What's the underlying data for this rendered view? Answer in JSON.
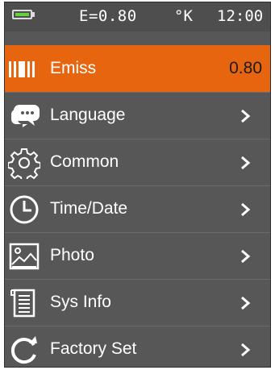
{
  "status": {
    "battery_icon": "battery-icon",
    "emissivity": "E=0.80",
    "unit": "°K",
    "time": "12:00"
  },
  "menu": [
    {
      "label": "Emiss",
      "value": "0.80",
      "icon": "emissivity-bars-icon",
      "selected": true
    },
    {
      "label": "Language",
      "icon": "speech-bubble-icon"
    },
    {
      "label": "Common",
      "icon": "gear-icon"
    },
    {
      "label": "Time/Date",
      "icon": "clock-icon"
    },
    {
      "label": "Photo",
      "icon": "image-icon"
    },
    {
      "label": "Sys Info",
      "icon": "document-icon"
    },
    {
      "label": "Factory Set",
      "icon": "reset-arrow-icon"
    }
  ],
  "colors": {
    "accent": "#e8650f",
    "background": "#575757",
    "battery": "#64d23c"
  }
}
